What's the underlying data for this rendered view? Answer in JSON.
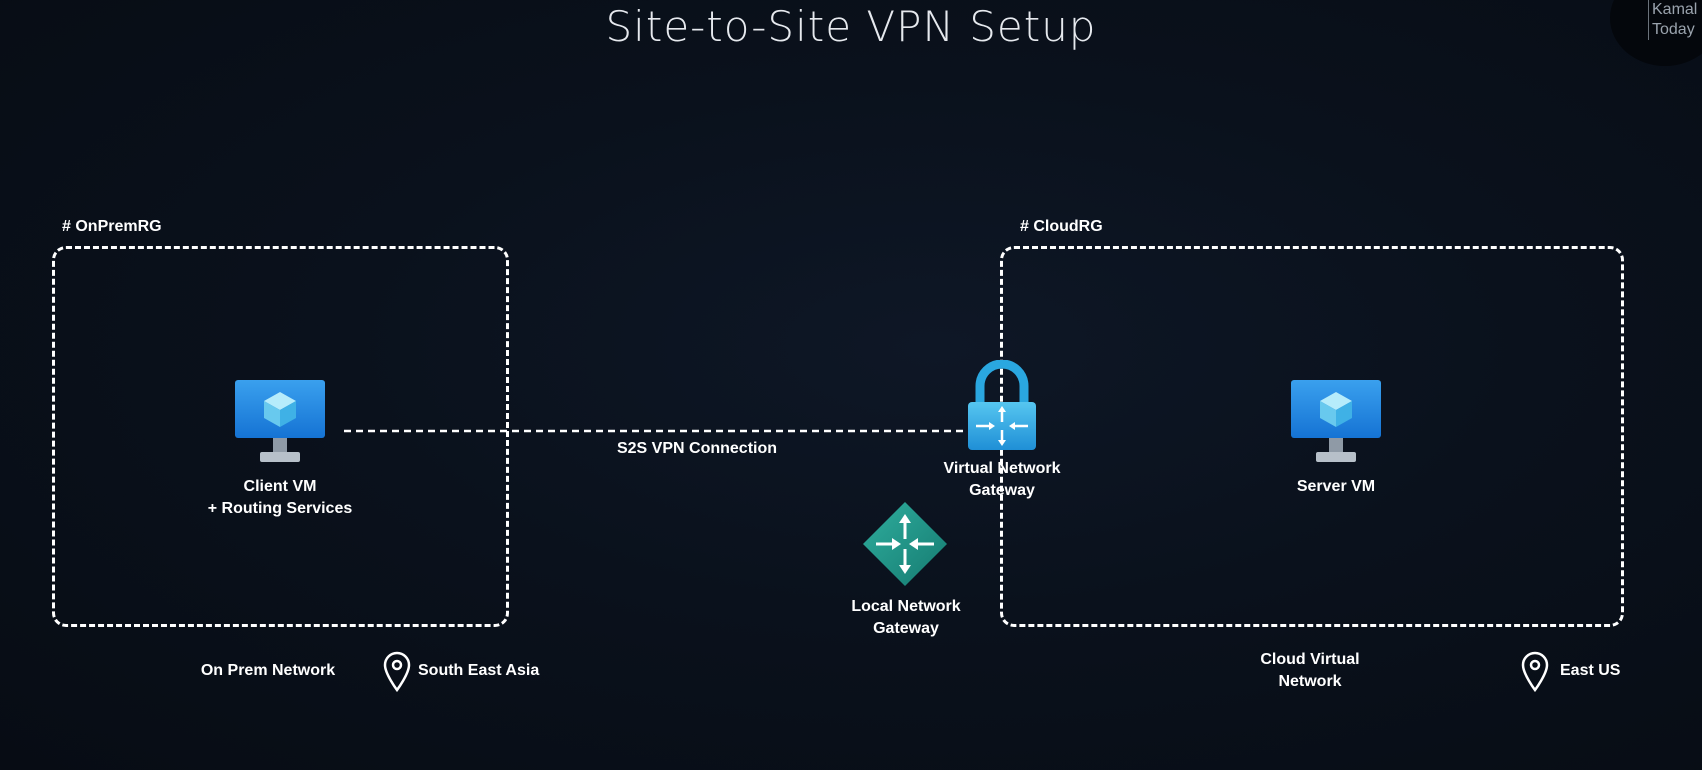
{
  "title": "Site-to-Site VPN Setup",
  "corner": {
    "line1": "Kamal",
    "line2": "Today"
  },
  "onprem": {
    "rg_label": "# OnPremRG",
    "vm_line1": "Client VM",
    "vm_line2": "+ Routing Services",
    "network_label": "On Prem Network",
    "location": "South East Asia"
  },
  "cloud": {
    "rg_label": "# CloudRG",
    "vm_label": "Server VM",
    "network_line1": "Cloud Virtual",
    "network_line2": "Network",
    "location": "East US"
  },
  "connection": {
    "label": "S2S VPN Connection"
  },
  "vng": {
    "line1": "Virtual Network",
    "line2": "Gateway"
  },
  "lng": {
    "line1": "Local Network",
    "line2": "Gateway"
  },
  "colors": {
    "background": "#0a111c",
    "monitor": "#1e90e8",
    "cube": "#8fdcf5",
    "lock": "#2aa7e0",
    "lng_diamond": "#1e8a7e"
  },
  "icons": {
    "client_vm": "monitor-vm-icon",
    "server_vm": "monitor-vm-icon",
    "vng": "lock-gateway-icon",
    "lng": "diamond-router-icon",
    "location": "map-pin-icon"
  }
}
